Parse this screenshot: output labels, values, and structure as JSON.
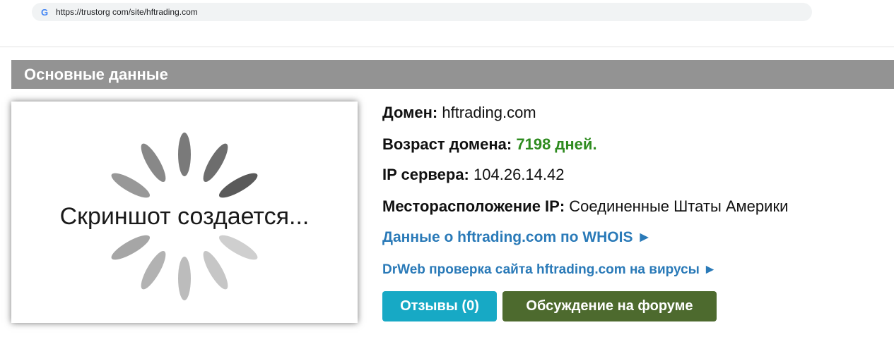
{
  "browser": {
    "url": "https://trustorg com/site/hftrading.com"
  },
  "section": {
    "title": "Основные данные"
  },
  "screenshot": {
    "placeholder_text": "Скриншот создается..."
  },
  "info": {
    "domain_label": "Домен:",
    "domain_value": "hftrading.com",
    "age_label": "Возраст домена:",
    "age_value": "7198 дней.",
    "ip_label": "IP сервера:",
    "ip_value": "104.26.14.42",
    "location_label": "Месторасположение IP:",
    "location_value": "Соединенные Штаты Америки",
    "whois_link": "Данные о hftrading.com по WHOIS ►",
    "drweb_link": "DrWeb проверка сайта hftrading.com на вирусы ►"
  },
  "buttons": {
    "reviews": "Отзывы (0)",
    "forum": "Обсуждение на форуме"
  },
  "colors": {
    "header_bg": "#939393",
    "age_green": "#2e8b1f",
    "link_blue": "#2a7ab8",
    "reviews_btn": "#17a9c5",
    "forum_btn": "#4d6a2e"
  }
}
